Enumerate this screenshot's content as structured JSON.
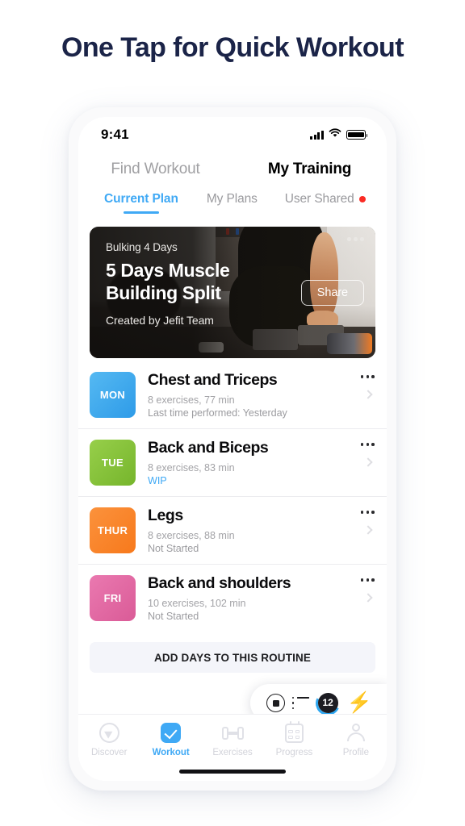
{
  "headline": "One Tap for Quick Workout",
  "status_bar": {
    "time": "9:41",
    "signal_icon": "cellular-signal-icon",
    "wifi_icon": "wifi-icon",
    "battery_icon": "battery-full-icon"
  },
  "top_tabs": [
    {
      "label": "Find Workout",
      "active": false
    },
    {
      "label": "My Training",
      "active": true
    }
  ],
  "sub_tabs": [
    {
      "label": "Current Plan",
      "active": true,
      "badge": false
    },
    {
      "label": "My Plans",
      "active": false,
      "badge": false
    },
    {
      "label": "User Shared",
      "active": false,
      "badge": true
    }
  ],
  "hero": {
    "kicker": "Bulking  4 Days",
    "title": "5 Days Muscle Building Split",
    "author": "Created by Jefit Team",
    "share_label": "Share",
    "more_icon": "ellipsis-icon"
  },
  "workouts": [
    {
      "day": "MON",
      "title": "Chest and Triceps",
      "meta": "8 exercises, 77 min",
      "status": "Last time performed: Yesterday",
      "status_style": "normal",
      "color_start": "#55b9f2",
      "color_end": "#2e9be8"
    },
    {
      "day": "TUE",
      "title": "Back and Biceps",
      "meta": "8 exercises, 83 min",
      "status": "WIP",
      "status_style": "wip",
      "color_start": "#97cf4a",
      "color_end": "#76b52c"
    },
    {
      "day": "THUR",
      "title": "Legs",
      "meta": "8 exercises, 88 min",
      "status": "Not Started",
      "status_style": "normal",
      "color_start": "#fb923c",
      "color_end": "#f7791c"
    },
    {
      "day": "FRI",
      "title": "Back and shoulders",
      "meta": "10 exercises, 102 min",
      "status": "Not Started",
      "status_style": "normal",
      "color_start": "#ea79b0",
      "color_end": "#da5b97"
    }
  ],
  "add_days_label": "ADD DAYS TO THIS ROUTINE",
  "action_pill": {
    "record_icon": "record-stop-icon",
    "list_icon": "list-icon",
    "count": "12",
    "bolt_icon": "lightning-bolt-icon"
  },
  "bottom_nav": [
    {
      "label": "Discover",
      "icon": "compass-icon",
      "active": false
    },
    {
      "label": "Workout",
      "icon": "check-square-icon",
      "active": true
    },
    {
      "label": "Exercises",
      "icon": "dumbbell-icon",
      "active": false
    },
    {
      "label": "Progress",
      "icon": "calendar-icon",
      "active": false
    },
    {
      "label": "Profile",
      "icon": "person-icon",
      "active": false
    }
  ],
  "colors": {
    "accent_blue": "#3fa9f5",
    "headline_navy": "#1b2448",
    "badge_red": "#fa2b24"
  }
}
